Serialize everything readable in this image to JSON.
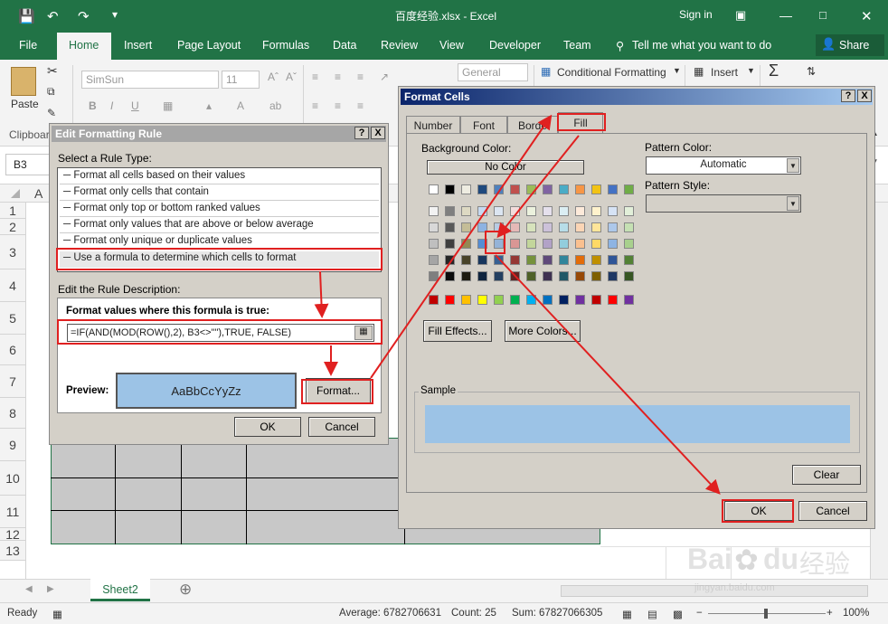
{
  "window": {
    "title": "百度经验.xlsx - Excel",
    "sign_in": "Sign in"
  },
  "menu": [
    "File",
    "Home",
    "Insert",
    "Page Layout",
    "Formulas",
    "Data",
    "Review",
    "View",
    "Developer",
    "Team"
  ],
  "tell_me": "Tell me what you want to do",
  "share": "Share",
  "ribbon": {
    "paste": "Paste",
    "clipboard": "Clipboar",
    "font_name": "SimSun",
    "font_size": "11",
    "number_format": "General",
    "conditional_formatting": "Conditional Formatting",
    "insert": "Insert",
    "bold": "B",
    "italic": "I",
    "underline": "U",
    "font_color": "A",
    "fill_color": "A",
    "wrap": "ab"
  },
  "name_box": "B3",
  "column_a": "A",
  "rows": [
    "1",
    "2",
    "3",
    "4",
    "5",
    "6",
    "7",
    "8",
    "9",
    "10",
    "11",
    "12",
    "13"
  ],
  "sheet_tab": "Sheet2",
  "status": {
    "ready": "Ready",
    "average": "Average: 6782706631",
    "count": "Count: 25",
    "sum": "Sum: 67827066305",
    "zoom": "100%"
  },
  "efr": {
    "title": "Edit Formatting Rule",
    "help": "?",
    "close": "X",
    "select_label": "Select a Rule Type:",
    "rules": [
      "Format all cells based on their values",
      "Format only cells that contain",
      "Format only top or bottom ranked values",
      "Format only values that are above or below average",
      "Format only unique or duplicate values",
      "Use a formula to determine which cells to format"
    ],
    "edit_label": "Edit the Rule Description:",
    "formula_label": "Format values where this formula is true:",
    "formula": "=IF(AND(MOD(ROW(),2), B3<>\"\"),TRUE, FALSE)",
    "preview_label": "Preview:",
    "preview_text": "AaBbCcYyZz",
    "format_btn": "Format...",
    "ok": "OK",
    "cancel": "Cancel"
  },
  "fc": {
    "title": "Format Cells",
    "help": "?",
    "close": "X",
    "tabs": [
      "Number",
      "Font",
      "Borde",
      "Fill"
    ],
    "bg_label": "Background Color:",
    "no_color": "No Color",
    "pattern_color_label": "Pattern Color:",
    "pattern_color_value": "Automatic",
    "pattern_style_label": "Pattern Style:",
    "fill_effects": "Fill Effects...",
    "more_colors": "More Colors...",
    "sample_label": "Sample",
    "clear": "Clear",
    "ok": "OK",
    "cancel": "Cancel"
  },
  "palette": [
    [
      "#ffffff",
      "#000000",
      "#eeece1",
      "#1f497d",
      "#4f81bd",
      "#c0504d",
      "#9bbb59",
      "#8064a2",
      "#4bacc6",
      "#f79646",
      "#f2c314",
      "#4472c4",
      "#70ad47"
    ],
    [
      "#f2f2f2",
      "#7f7f7f",
      "#ddd9c3",
      "#c6d9f0",
      "#dbe5f1",
      "#f2dcdb",
      "#ebf1dd",
      "#e5e0ec",
      "#dbeef3",
      "#fdeada",
      "#fff2cc",
      "#d6e3f5",
      "#e2efd9"
    ],
    [
      "#d8d8d8",
      "#595959",
      "#c4bd97",
      "#8db3e2",
      "#b8cce4",
      "#e5b9b7",
      "#d7e3bc",
      "#ccc1d9",
      "#b7dde8",
      "#fbd5b5",
      "#ffe599",
      "#adc8ea",
      "#c5e0b3"
    ],
    [
      "#bfbfbf",
      "#3f3f3f",
      "#938953",
      "#548dd4",
      "#95b3d7",
      "#d99694",
      "#c3d69b",
      "#b2a2c7",
      "#92cddc",
      "#fac08f",
      "#ffd966",
      "#8eb4e3",
      "#a8d08d"
    ],
    [
      "#a5a5a5",
      "#262626",
      "#494429",
      "#17365d",
      "#366092",
      "#953734",
      "#76923c",
      "#5f497a",
      "#31859b",
      "#e36c09",
      "#bf8f00",
      "#2f5597",
      "#538135"
    ],
    [
      "#7f7f7f",
      "#0c0c0c",
      "#1d1b10",
      "#0f243e",
      "#244061",
      "#632423",
      "#4f6128",
      "#3f3151",
      "#205867",
      "#974806",
      "#7f6000",
      "#1f3864",
      "#375623"
    ],
    [
      "#c00000",
      "#ff0000",
      "#ffc000",
      "#ffff00",
      "#92d050",
      "#00b050",
      "#00b0f0",
      "#0070c0",
      "#002060",
      "#7030a0",
      "#c00000",
      "#ff0000",
      "#7030a0"
    ]
  ],
  "colors": {
    "excel_green": "#217346",
    "dialog_gray": "#d4d0c8",
    "preview_blue": "#9cc3e6",
    "annotation_red": "#e02020"
  },
  "watermark": {
    "brand": "Bai",
    "brand2": "du",
    "cn": "经验",
    "url": "jingyan.baidu.com"
  }
}
